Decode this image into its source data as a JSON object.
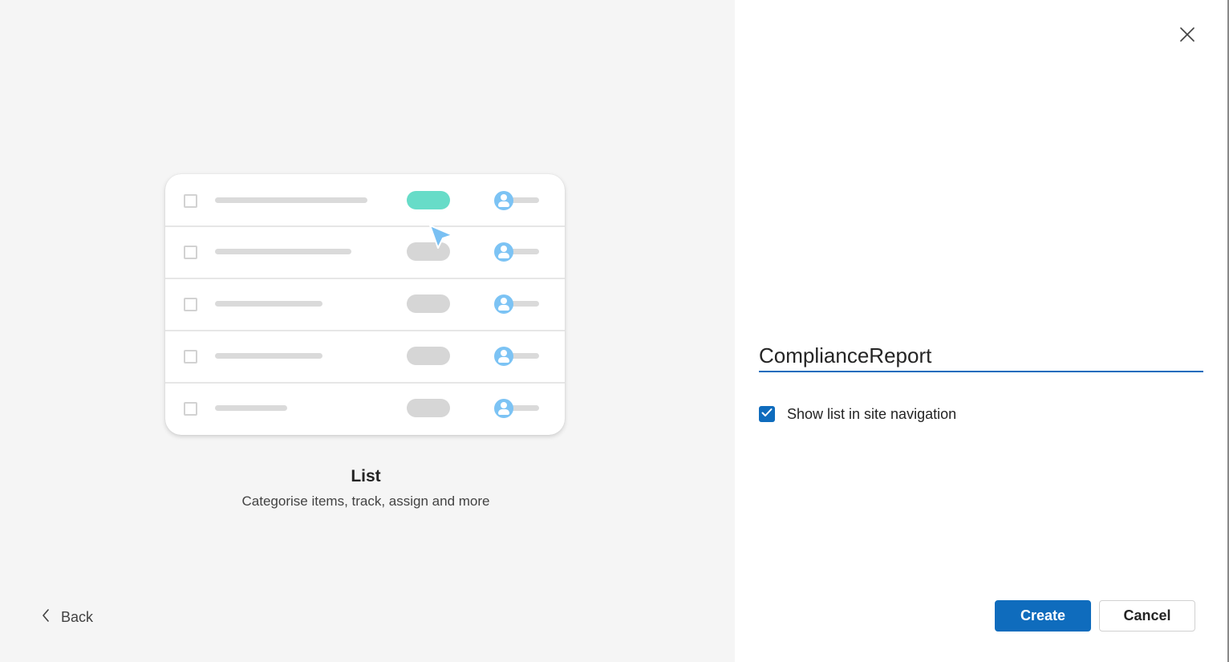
{
  "preview": {
    "title": "List",
    "description": "Categorise items, track, assign and more",
    "back_label": "Back",
    "icons": {
      "back": "chevron-left-icon",
      "cursor": "pointer-cursor-icon",
      "avatar": "person-avatar-icon",
      "checkbox": "checkbox-icon"
    },
    "colors": {
      "active_pill": "#67dcc8",
      "pill": "#d6d6d6",
      "avatar": "#7cc3f4",
      "cursor": "#79c0f3"
    }
  },
  "form": {
    "close_icon": "close-icon",
    "list_name": "ComplianceReport",
    "show_in_nav_label": "Show list in site navigation",
    "show_in_nav_checked": true,
    "create_label": "Create",
    "cancel_label": "Cancel",
    "accent_color": "#0f6cbd"
  }
}
